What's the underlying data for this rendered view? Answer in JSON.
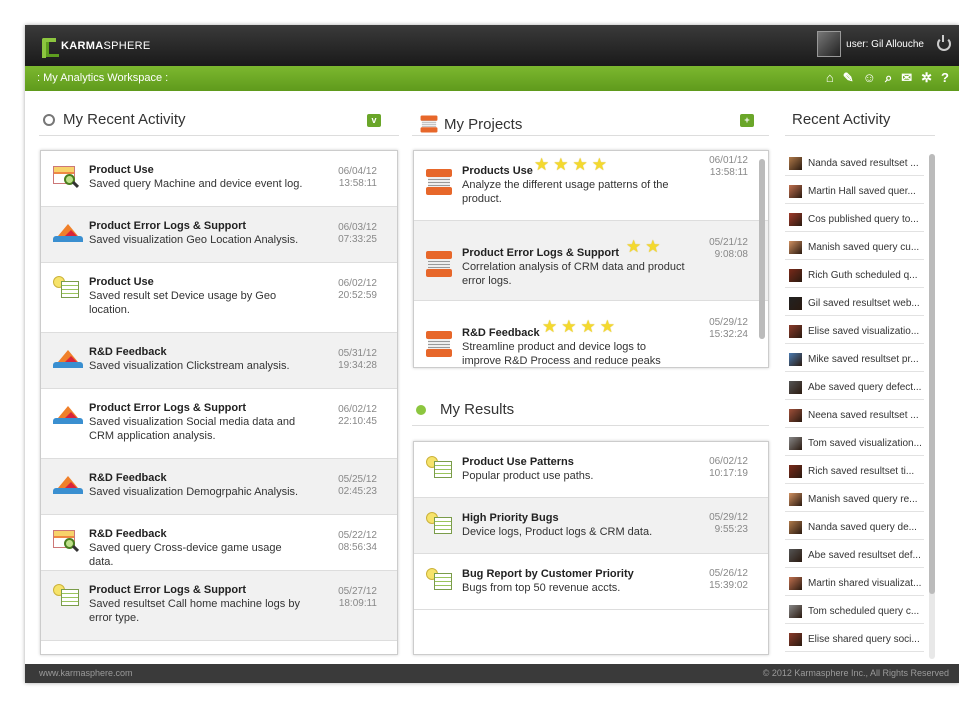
{
  "app": {
    "logo_bold": "KARMA",
    "logo_rest": "SPHERE"
  },
  "user": {
    "label": "user: Gil Allouche"
  },
  "workspace": {
    "title": ": My Analytics Workspace :"
  },
  "toolbar": [
    "home-icon",
    "notes-icon",
    "people-icon",
    "search-icon",
    "chat-icon",
    "settings-icon",
    "help-icon"
  ],
  "toolbar_glyphs": {
    "help": "?"
  },
  "recent_activity": {
    "title": "My Recent Activity",
    "btn": "v",
    "rows": [
      {
        "icon": "query",
        "title": "Product Use",
        "desc": "Saved query Machine and device event log.",
        "date": "06/04/12",
        "time": "13:58:11"
      },
      {
        "icon": "viz",
        "title": "Product Error Logs & Support",
        "desc": "Saved visualization Geo Location Analysis.",
        "date": "06/03/12",
        "time": "07:33:25"
      },
      {
        "icon": "result",
        "title": "Product Use",
        "desc": "Saved result set Device usage by Geo location.",
        "date": "06/02/12",
        "time": "20:52:59"
      },
      {
        "icon": "viz",
        "title": "R&D Feedback",
        "desc": "Saved visualization Clickstream analysis.",
        "date": "05/31/12",
        "time": "19:34:28"
      },
      {
        "icon": "viz",
        "title": "Product Error Logs & Support",
        "desc": "Saved visualization Social media data and CRM application analysis.",
        "date": "06/02/12",
        "time": "22:10:45"
      },
      {
        "icon": "viz",
        "title": "R&D Feedback",
        "desc": "Saved visualization Demogrpahic Analysis.",
        "date": "05/25/12",
        "time": "02:45:23"
      },
      {
        "icon": "query",
        "title": "R&D Feedback",
        "desc": "Saved query Cross-device game usage data.",
        "date": "05/22/12",
        "time": "08:56:34"
      },
      {
        "icon": "result",
        "title": "Product Error Logs & Support",
        "desc": "Saved resultset Call home machine logs by error type.",
        "date": "05/27/12",
        "time": "18:09:11"
      }
    ]
  },
  "projects": {
    "title": "My Projects",
    "btn": "+",
    "rows": [
      {
        "title": "Products Use",
        "stars": 4,
        "desc": "Analyze the different usage patterns of the product.",
        "date": "06/01/12",
        "time": "13:58:11"
      },
      {
        "title": "Product Error Logs & Support",
        "stars": 2,
        "desc": "Correlation analysis of CRM data and product error logs.",
        "date": "05/21/12",
        "time": "9:08:08"
      },
      {
        "title": "R&D Feedback",
        "stars": 4,
        "desc": "Streamline product and device logs to improve R&D Process and reduce peaks",
        "date": "05/29/12",
        "time": "15:32:24"
      }
    ]
  },
  "results": {
    "title": "My Results",
    "rows": [
      {
        "title": "Product Use Patterns",
        "desc": "Popular product use paths.",
        "date": "06/02/12",
        "time": "10:17:19"
      },
      {
        "title": "High Priority Bugs",
        "desc": "Device logs, Product logs & CRM data.",
        "date": "05/29/12",
        "time": "9:55:23"
      },
      {
        "title": "Bug Report by Customer Priority",
        "desc": "Bugs from top 50 revenue accts.",
        "date": "05/26/12",
        "time": "15:39:02"
      }
    ]
  },
  "feed": {
    "title": "Recent Activity",
    "items": [
      "Nanda saved resultset ...",
      "Martin Hall saved quer...",
      "Cos published query to...",
      "Manish saved query cu...",
      "Rich Guth scheduled q...",
      "Gil saved resultset web...",
      "Elise saved visualizatio...",
      "Mike saved resultset pr...",
      "Abe saved query defect...",
      "Neena saved resultset ...",
      "Tom saved visualization...",
      "Rich saved resultset ti...",
      "Manish saved query re...",
      "Nanda saved query de...",
      "Abe saved resultset def...",
      "Martin shared visualizat...",
      "Tom scheduled query c...",
      "Elise shared query soci..."
    ]
  },
  "footer": {
    "left": "www.karmasphere.com",
    "right": "© 2012 Karmasphere Inc., All Rights Reserved"
  }
}
